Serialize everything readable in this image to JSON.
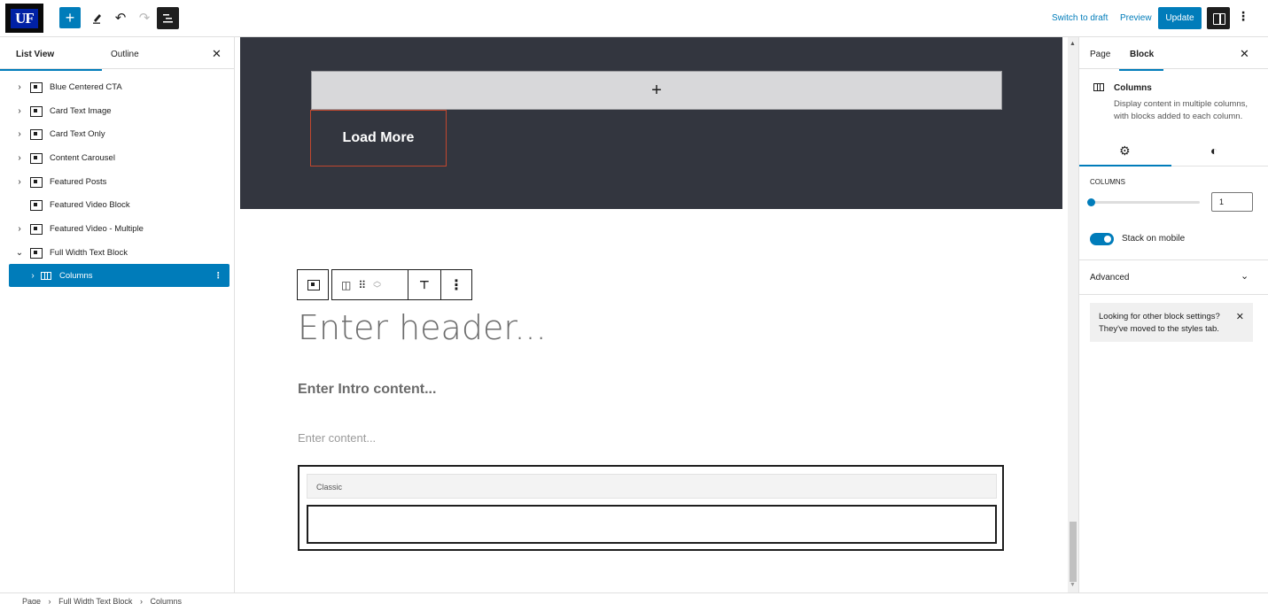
{
  "header": {
    "logo_text": "UF",
    "switch_to_draft": "Switch to draft",
    "preview": "Preview",
    "update": "Update"
  },
  "list_view": {
    "tabs": [
      "List View",
      "Outline"
    ],
    "items": [
      {
        "label": "Blue Centered CTA",
        "expanded": false
      },
      {
        "label": "Card Text Image",
        "expanded": false
      },
      {
        "label": "Card Text Only",
        "expanded": false
      },
      {
        "label": "Content Carousel",
        "expanded": false
      },
      {
        "label": "Featured Posts",
        "expanded": false
      },
      {
        "label": "Featured Video Block",
        "expanded": null
      },
      {
        "label": "Featured Video - Multiple",
        "expanded": false
      },
      {
        "label": "Full Width Text Block",
        "expanded": true
      },
      {
        "label": "Columns",
        "expanded": false,
        "selected": true
      }
    ]
  },
  "canvas": {
    "load_more": "Load More",
    "heading_placeholder": "Enter header...",
    "intro_placeholder": "Enter Intro content...",
    "content_placeholder": "Enter content...",
    "classic_label": "Classic"
  },
  "sidebar": {
    "tabs": [
      "Page",
      "Block"
    ],
    "block_title": "Columns",
    "block_description": "Display content in multiple columns, with blocks added to each column.",
    "columns_label": "COLUMNS",
    "columns_value": "1",
    "stack_on_mobile": "Stack on mobile",
    "stack_on_mobile_enabled": true,
    "advanced": "Advanced",
    "notice": "Looking for other block settings? They've moved to the styles tab."
  },
  "breadcrumb": [
    "Page",
    "Full Width Text Block",
    "Columns"
  ],
  "colors": {
    "accent": "#007cba",
    "dark_section": "#33363f",
    "load_more_border": "#c2472e"
  }
}
